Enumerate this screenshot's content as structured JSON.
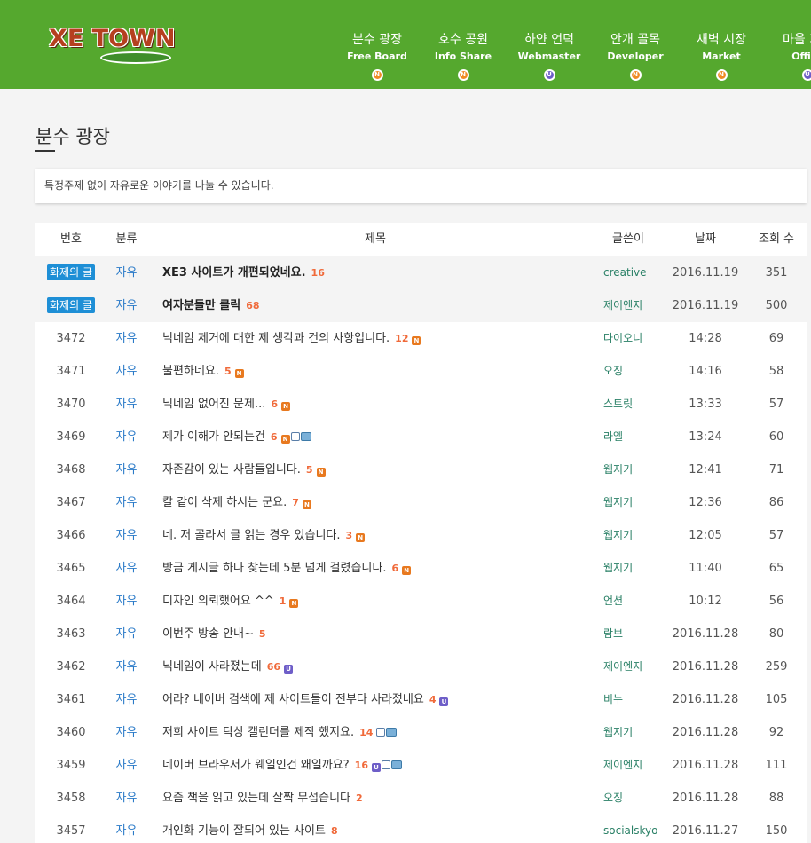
{
  "header": {
    "logo_text": "XE TOWN",
    "nav": [
      {
        "ko": "분수 광장",
        "en": "Free Board",
        "mark": "N"
      },
      {
        "ko": "호수 공원",
        "en": "Info Share",
        "mark": "N"
      },
      {
        "ko": "하얀 언덕",
        "en": "Webmaster",
        "mark": "U"
      },
      {
        "ko": "안개 골목",
        "en": "Developer",
        "mark": "N"
      },
      {
        "ko": "새벽 시장",
        "en": "Market",
        "mark": "N"
      },
      {
        "ko": "마을 회관",
        "en": "Office",
        "mark": "U"
      }
    ]
  },
  "page": {
    "title": "분수 광장",
    "description": "특정주제 없이 자유로운 이야기를 나눌 수 있습니다."
  },
  "table": {
    "headers": {
      "no": "번호",
      "category": "분류",
      "title": "제목",
      "author": "글쓴이",
      "date": "날짜",
      "views": "조회 수"
    },
    "rows": [
      {
        "no": "화제의 글",
        "notice": true,
        "category": "자유",
        "title": "XE3 사이트가 개편되었네요.",
        "comments": "16",
        "icons": [],
        "author": "creative",
        "date": "2016.11.19",
        "views": "351"
      },
      {
        "no": "화제의 글",
        "notice": true,
        "category": "자유",
        "title": "여자분들만 클릭",
        "comments": "68",
        "icons": [],
        "author": "제이엔지",
        "date": "2016.11.19",
        "views": "500"
      },
      {
        "no": "3472",
        "category": "자유",
        "title": "닉네임 제거에 대한 제 생각과 건의 사항입니다.",
        "comments": "12",
        "icons": [
          "new"
        ],
        "author": "다이오니",
        "date": "14:28",
        "views": "69"
      },
      {
        "no": "3471",
        "category": "자유",
        "title": "불편하네요.",
        "comments": "5",
        "icons": [
          "new"
        ],
        "author": "오징",
        "date": "14:16",
        "views": "58"
      },
      {
        "no": "3470",
        "category": "자유",
        "title": "닉네임 없어진 문제...",
        "comments": "6",
        "icons": [
          "new"
        ],
        "author": "스트릿",
        "date": "13:33",
        "views": "57"
      },
      {
        "no": "3469",
        "category": "자유",
        "title": "제가 이해가 안되는건",
        "comments": "6",
        "icons": [
          "new",
          "file",
          "image"
        ],
        "author": "라엘",
        "date": "13:24",
        "views": "60"
      },
      {
        "no": "3468",
        "category": "자유",
        "title": "자존감이 있는 사람들입니다.",
        "comments": "5",
        "icons": [
          "new"
        ],
        "author": "웹지기",
        "date": "12:41",
        "views": "71"
      },
      {
        "no": "3467",
        "category": "자유",
        "title": "칼 같이 삭제 하시는 군요.",
        "comments": "7",
        "icons": [
          "new"
        ],
        "author": "웹지기",
        "date": "12:36",
        "views": "86"
      },
      {
        "no": "3466",
        "category": "자유",
        "title": "네. 저 골라서 글 읽는 경우 있습니다.",
        "comments": "3",
        "icons": [
          "new"
        ],
        "author": "웹지기",
        "date": "12:05",
        "views": "57"
      },
      {
        "no": "3465",
        "category": "자유",
        "title": "방금 게시글 하나 찾는데 5분 넘게 걸렸습니다.",
        "comments": "6",
        "icons": [
          "new"
        ],
        "author": "웹지기",
        "date": "11:40",
        "views": "65"
      },
      {
        "no": "3464",
        "category": "자유",
        "title": "디자인 의뢰했어요 ^^",
        "comments": "1",
        "icons": [
          "new"
        ],
        "author": "언션",
        "date": "10:12",
        "views": "56"
      },
      {
        "no": "3463",
        "category": "자유",
        "title": "이번주 방송 안내~",
        "comments": "5",
        "icons": [],
        "author": "람보",
        "date": "2016.11.28",
        "views": "80"
      },
      {
        "no": "3462",
        "category": "자유",
        "title": "닉네임이 사라졌는데",
        "comments": "66",
        "icons": [
          "update"
        ],
        "author": "제이엔지",
        "date": "2016.11.28",
        "views": "259"
      },
      {
        "no": "3461",
        "category": "자유",
        "title": "어라? 네이버 검색에 제 사이트들이 전부다 사라졌네요",
        "comments": "4",
        "icons": [
          "update"
        ],
        "author": "비누",
        "date": "2016.11.28",
        "views": "105"
      },
      {
        "no": "3460",
        "category": "자유",
        "title": "저희 사이트 탁상 캘린더를 제작 했지요.",
        "comments": "14",
        "icons": [
          "file",
          "image"
        ],
        "author": "웹지기",
        "date": "2016.11.28",
        "views": "92"
      },
      {
        "no": "3459",
        "category": "자유",
        "title": "네이버 브라우저가 웨일인건 왜일까요?",
        "comments": "16",
        "icons": [
          "update",
          "file",
          "image"
        ],
        "author": "제이엔지",
        "date": "2016.11.28",
        "views": "111"
      },
      {
        "no": "3458",
        "category": "자유",
        "title": "요즘 책을 읽고 있는데 살짝 무섭습니다",
        "comments": "2",
        "icons": [],
        "author": "오징",
        "date": "2016.11.28",
        "views": "88"
      },
      {
        "no": "3457",
        "category": "자유",
        "title": "개인화 기능이 잘되어 있는 사이트",
        "comments": "8",
        "icons": [],
        "author": "socialskyo",
        "date": "2016.11.27",
        "views": "150"
      }
    ]
  }
}
